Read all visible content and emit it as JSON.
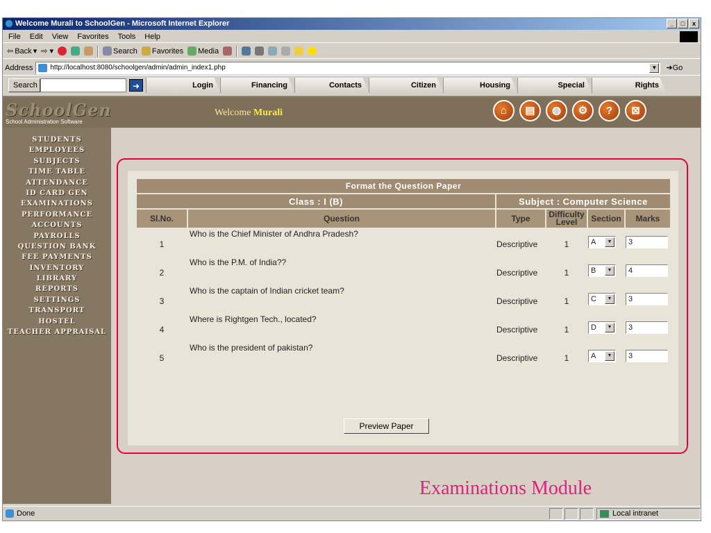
{
  "window": {
    "title": "Welcome Murali to SchoolGen - Microsoft Internet Explorer",
    "controls": [
      "_",
      "□",
      "x"
    ]
  },
  "menu": [
    "File",
    "Edit",
    "View",
    "Favorites",
    "Tools",
    "Help"
  ],
  "toolbar": {
    "back": "Back",
    "search": "Search",
    "favorites": "Favorites",
    "media": "Media"
  },
  "address": {
    "label": "Address",
    "url": "http://localhost:8080/schoolgen/admin/admin_index1.php",
    "go": "Go"
  },
  "navbar": {
    "search_label": "Search",
    "search_value": "",
    "tabs": [
      "Login",
      "Financing",
      "Contacts",
      "Citizen",
      "Housing",
      "Special",
      "Rights"
    ]
  },
  "app": {
    "logo_title": "SchoolGen",
    "logo_subtitle": "School Administration Software",
    "welcome_prefix": "Welcome",
    "welcome_name": "Murali",
    "header_icons": [
      "home-icon",
      "book-icon",
      "globe-icon",
      "tools-icon",
      "help-icon",
      "close-icon"
    ],
    "sidebar": [
      "STUDENTS",
      "EMPLOYEES",
      "SUBJECTS",
      "TIME TABLE",
      "ATTENDANCE",
      "ID CARD GEN",
      "EXAMINATIONS",
      "PERFORMANCE",
      "ACCOUNTS",
      "PAYROLLS",
      "QUESTION BANK",
      "FEE PAYMENTS",
      "INVENTORY",
      "LIBRARY",
      "REPORTS",
      "SETTINGS",
      "TRANSPORT",
      "HOSTEL",
      "TEACHER APPRAISAL"
    ]
  },
  "paper": {
    "title": "Format the Question Paper",
    "class_label": "Class : I (B)",
    "subject_label": "Subject : Computer Science",
    "columns": {
      "slno": "Sl.No.",
      "question": "Question",
      "type": "Type",
      "difficulty": "Difficulty Level",
      "section": "Section",
      "marks": "Marks"
    },
    "rows": [
      {
        "slno": "1",
        "question": "Who is the Chief Minister of Andhra Pradesh?",
        "type": "Descriptive",
        "difficulty": "1",
        "section": "A",
        "marks": "3"
      },
      {
        "slno": "2",
        "question": "Who is the P.M. of India??",
        "type": "Descriptive",
        "difficulty": "1",
        "section": "B",
        "marks": "4"
      },
      {
        "slno": "3",
        "question": "Who is the captain of Indian cricket team?",
        "type": "Descriptive",
        "difficulty": "1",
        "section": "C",
        "marks": "3"
      },
      {
        "slno": "4",
        "question": "Where is Rightgen Tech., located?",
        "type": "Descriptive",
        "difficulty": "1",
        "section": "D",
        "marks": "3"
      },
      {
        "slno": "5",
        "question": "Who is the president of pakistan?",
        "type": "Descriptive",
        "difficulty": "1",
        "section": "A",
        "marks": "3"
      }
    ],
    "preview_button": "Preview Paper"
  },
  "module_label": "Examinations Module",
  "status": {
    "text": "Done",
    "zone": "Local intranet"
  }
}
